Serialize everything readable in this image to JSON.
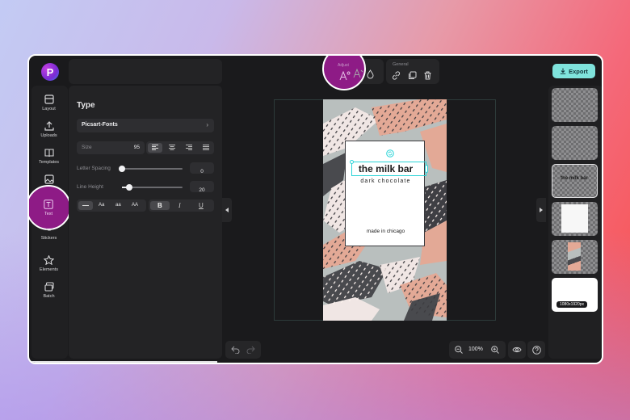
{
  "app": {
    "logo_letter": "P"
  },
  "sidebar": {
    "items": [
      {
        "label": "Layout",
        "icon": "layout-icon"
      },
      {
        "label": "Uploads",
        "icon": "upload-icon"
      },
      {
        "label": "Templates",
        "icon": "book-icon"
      },
      {
        "label": "",
        "icon": "image-icon"
      },
      {
        "label": "Text",
        "icon": "text-icon",
        "active": true
      },
      {
        "label": "Stickers",
        "icon": "sticker-icon"
      },
      {
        "label": "Elements",
        "icon": "star-icon"
      },
      {
        "label": "Batch",
        "icon": "batch-icon"
      }
    ]
  },
  "type_panel": {
    "title": "Type",
    "font": "Picsart-Fonts",
    "size_label": "Size",
    "size_value": "95",
    "letter_spacing_label": "Letter Spacing",
    "letter_spacing_value": "0",
    "letter_spacing_level": 0,
    "line_height_label": "Line Height",
    "line_height_value": "20",
    "line_height_level": 0.12,
    "case_options": [
      "Aa",
      "aa",
      "AA"
    ],
    "style_options": [
      "B",
      "I",
      "U"
    ]
  },
  "toolbar": {
    "adjust_label": "Adjust",
    "general_label": "General"
  },
  "export": {
    "label": "Export"
  },
  "canvas": {
    "title": "the milk bar",
    "subtitle": "dark chocolate",
    "footer": "made in chicago"
  },
  "zoom": {
    "value": "100%"
  },
  "layers": {
    "size_badge": "1080x1920px",
    "text_layer": "the milk bar"
  },
  "colors": {
    "accent": "#2ad4d8",
    "brand_purple": "#8e1b86",
    "export_bg": "#7fe3dc"
  }
}
